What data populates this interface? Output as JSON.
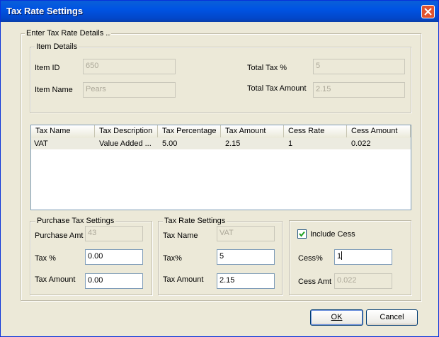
{
  "window": {
    "title": "Tax Rate Settings"
  },
  "outer_group": {
    "legend": "Enter Tax Rate Details .."
  },
  "item_details": {
    "legend": "Item Details",
    "item_id_label": "Item ID",
    "item_id_value": "650",
    "item_name_label": "Item Name",
    "item_name_value": "Pears",
    "total_tax_label": "Total Tax %",
    "total_tax_value": "5",
    "total_tax_amount_label": "Total Tax Amount",
    "total_tax_amount_value": "2.15"
  },
  "tax_table": {
    "columns": [
      "Tax Name",
      "Tax Description",
      "Tax Percentage",
      "Tax Amount",
      "Cess Rate",
      "Cess Amount"
    ],
    "rows": [
      [
        "VAT",
        "Value Added ...",
        "5.00",
        "2.15",
        "1",
        "0.022"
      ]
    ]
  },
  "purchase_tax": {
    "legend": "Purchase Tax Settings",
    "purchase_amt_label": "Purchase  Amt",
    "purchase_amt_value": "43",
    "tax_pct_label": "Tax %",
    "tax_pct_value": "0.00",
    "tax_amount_label": "Tax Amount",
    "tax_amount_value": "0.00"
  },
  "tax_rate": {
    "legend": "Tax Rate Settings",
    "tax_name_label": "Tax Name",
    "tax_name_value": "VAT",
    "tax_pct_label": "Tax%",
    "tax_pct_value": "5",
    "tax_amount_label": "Tax Amount",
    "tax_amount_value": "2.15"
  },
  "cess": {
    "include_label": "Include Cess",
    "include_checked": true,
    "cess_pct_label": "Cess%",
    "cess_pct_value": "1",
    "cess_amt_label": "Cess Amt",
    "cess_amt_value": "0.022"
  },
  "buttons": {
    "ok": "OK",
    "cancel": "Cancel"
  },
  "colors": {
    "titlebar": "#0054e3",
    "close_button": "#e0532f",
    "dialog_bg": "#ece9d8",
    "field_border": "#7f9db9"
  }
}
